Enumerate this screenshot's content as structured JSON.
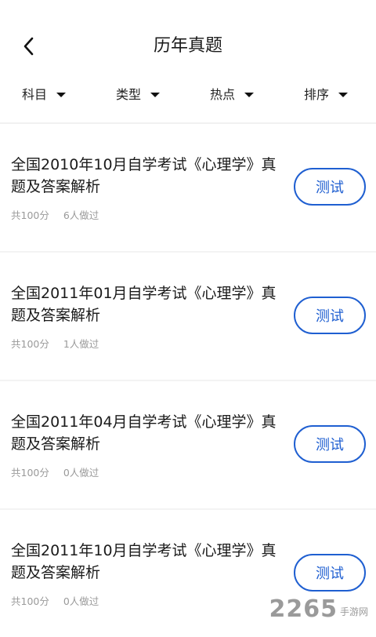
{
  "header": {
    "title": "历年真题",
    "back_icon": "chevron-left-icon"
  },
  "filters": [
    {
      "label": "科目"
    },
    {
      "label": "类型"
    },
    {
      "label": "热点"
    },
    {
      "label": "排序"
    }
  ],
  "items": [
    {
      "title": "全国2010年10月自学考试《心理学》真题及答案解析",
      "score": "共100分",
      "done": "6人做过",
      "button": "测试"
    },
    {
      "title": "全国2011年01月自学考试《心理学》真题及答案解析",
      "score": "共100分",
      "done": "1人做过",
      "button": "测试"
    },
    {
      "title": "全国2011年04月自学考试《心理学》真题及答案解析",
      "score": "共100分",
      "done": "0人做过",
      "button": "测试"
    },
    {
      "title": "全国2011年10月自学考试《心理学》真题及答案解析",
      "score": "共100分",
      "done": "0人做过",
      "button": "测试"
    }
  ],
  "watermark": {
    "number": "2265",
    "text": "手游网"
  },
  "colors": {
    "accent": "#1f5fd1",
    "meta": "#9a9a9a"
  }
}
